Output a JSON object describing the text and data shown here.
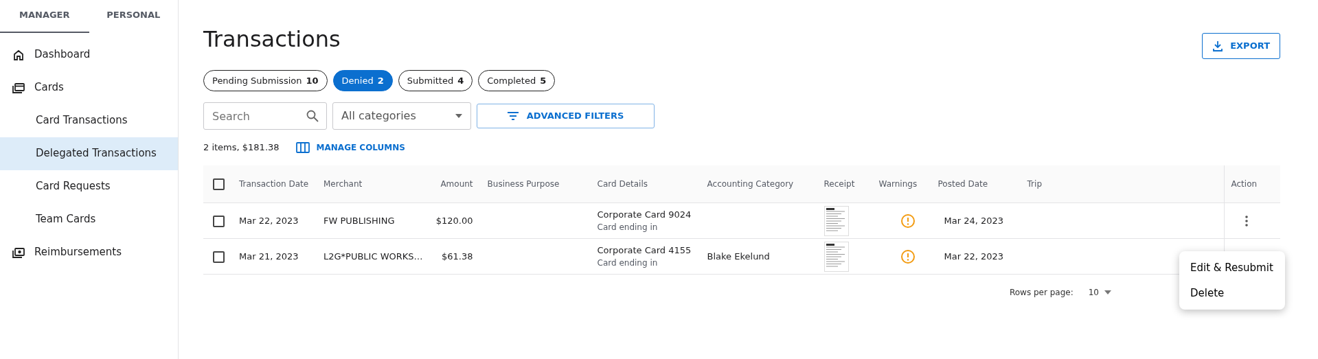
{
  "sidebar": {
    "tabs": [
      {
        "label": "MANAGER",
        "selected": true
      },
      {
        "label": "PERSONAL",
        "selected": false
      }
    ],
    "items": [
      {
        "label": "Dashboard",
        "kind": "home",
        "selected": false
      },
      {
        "label": "Cards",
        "kind": "cards",
        "selected": false,
        "children": [
          {
            "label": "Card Transactions",
            "selected": false
          },
          {
            "label": "Delegated Transactions",
            "selected": true
          },
          {
            "label": "Card Requests",
            "selected": false
          },
          {
            "label": "Team Cards",
            "selected": false
          }
        ]
      },
      {
        "label": "Reimbursements",
        "kind": "money",
        "selected": false
      }
    ]
  },
  "page": {
    "title": "Transactions",
    "export_button": "EXPORT"
  },
  "status_chips": [
    {
      "label": "Pending Submission",
      "count": "10",
      "selected": false
    },
    {
      "label": "Denied",
      "count": "2",
      "selected": true
    },
    {
      "label": "Submitted",
      "count": "4",
      "selected": false
    },
    {
      "label": "Completed",
      "count": "5",
      "selected": false
    }
  ],
  "filters": {
    "search": {
      "placeholder": "Search"
    },
    "category": {
      "value": "All categories"
    },
    "advanced_button": "ADVANCED FILTERS"
  },
  "summary": {
    "text": "2 items, $181.38",
    "manage_columns": "MANAGE COLUMNS"
  },
  "table": {
    "select_all_checked": false,
    "columns": [
      "Transaction Date",
      "Merchant",
      "Amount",
      "Business Purpose",
      "Card Details",
      "Accounting Category",
      "Receipt",
      "Warnings",
      "Posted Date",
      "Trip",
      "Action"
    ],
    "rows": [
      {
        "checked": false,
        "date": "Mar 22, 2023",
        "merchant": "FW PUBLISHING",
        "amount": "$120.00",
        "card": "Corporate Card 9024",
        "card_note": "Card ending in",
        "receipt": true,
        "warning": true,
        "posted": "Mar 24, 2023"
      },
      {
        "checked": false,
        "date": "Mar 21, 2023",
        "merchant": "L2G*PUBLIC WORKS…",
        "amount": "$61.38",
        "card": "Corporate Card 4155",
        "card_note": "Card ending in",
        "category": "Blake Ekelund",
        "receipt": true,
        "warning": true,
        "posted": "Mar 22, 2023"
      }
    ]
  },
  "row_menu": {
    "items": [
      "Edit & Resubmit",
      "Delete"
    ]
  },
  "pagination": {
    "rows_label": "Rows per page:",
    "rows_value": "10"
  }
}
